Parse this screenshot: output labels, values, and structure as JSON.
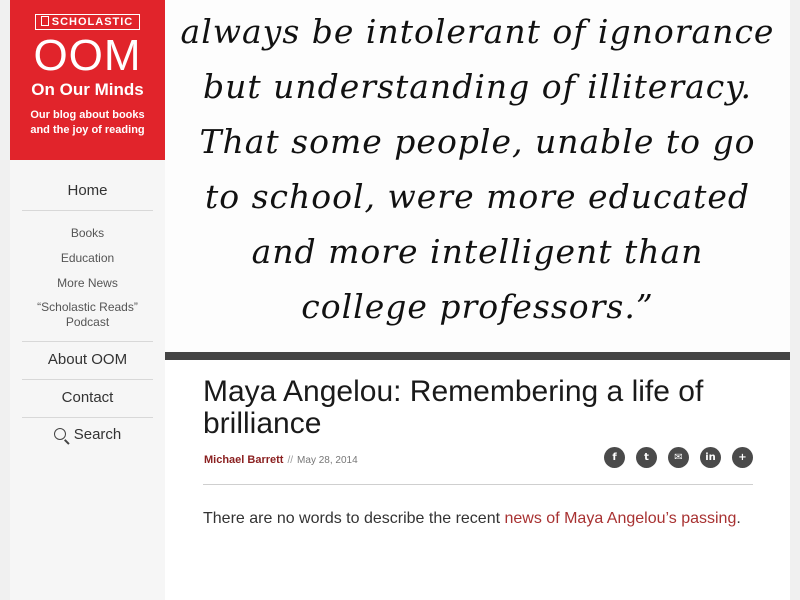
{
  "sidebar": {
    "brand": {
      "logo": "SCHOLASTIC",
      "title": "OOM",
      "subtitle": "On Our Minds",
      "tagline_line1": "Our blog about books",
      "tagline_line2": "and the joy of reading"
    },
    "home": "Home",
    "sub_items": [
      "Books",
      "Education",
      "More News"
    ],
    "podcast_line1": "“Scholastic Reads”",
    "podcast_line2": "Podcast",
    "about": "About OOM",
    "contact": "Contact",
    "search": "Search"
  },
  "hero": {
    "lines": [
      "always be intolerant of ignorance",
      "but understanding of illiteracy.",
      "That some people, unable to go",
      "to school, were more educated",
      "and more intelligent than",
      "college professors.”"
    ]
  },
  "article": {
    "title": "Maya Angelou: Remembering a life of brilliance",
    "author": "Michael Barrett",
    "separator": "//",
    "date": "May 28, 2014",
    "share": [
      "f",
      "t",
      "✉",
      "in",
      "+"
    ],
    "body_prefix": "There are no words to describe the recent ",
    "body_link": "news of Maya Angelou’s passing",
    "body_suffix": "."
  },
  "colors": {
    "brand_red": "#e1242b",
    "link_red": "#a83232",
    "author_red": "#8a1f1f"
  }
}
